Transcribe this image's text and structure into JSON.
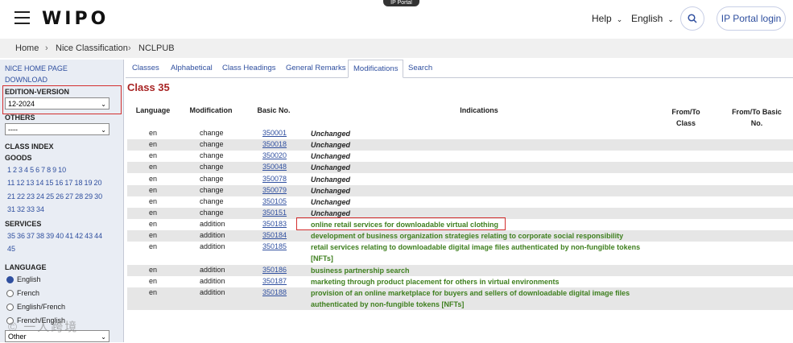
{
  "header": {
    "logo": "WIPO",
    "badge": "IP Portal",
    "help": "Help",
    "language": "English",
    "login": "IP Portal login"
  },
  "breadcrumb": [
    "Home",
    "Nice Classification",
    "NCLPUB"
  ],
  "sidebar": {
    "links": [
      "NICE HOME PAGE",
      "DOWNLOAD"
    ],
    "edition_label": "EDITION-VERSION",
    "edition_value": "12-2024",
    "others_label": "OTHERS",
    "others_value": "----",
    "class_index_label": "CLASS INDEX",
    "goods_label": "GOODS",
    "goods_rows": [
      [
        "1",
        "2",
        "3",
        "4",
        "5",
        "6",
        "7",
        "8",
        "9",
        "10"
      ],
      [
        "11",
        "12",
        "13",
        "14",
        "15",
        "16",
        "17",
        "18",
        "19",
        "20"
      ],
      [
        "21",
        "22",
        "23",
        "24",
        "25",
        "26",
        "27",
        "28",
        "29",
        "30"
      ],
      [
        "31",
        "32",
        "33",
        "34"
      ]
    ],
    "services_label": "SERVICES",
    "services_rows": [
      [
        "35",
        "36",
        "37",
        "38",
        "39",
        "40",
        "41",
        "42",
        "43",
        "44"
      ],
      [
        "45"
      ]
    ],
    "language_label": "LANGUAGE",
    "language_options": [
      "English",
      "French",
      "English/French",
      "French/English"
    ],
    "language_selected": "English",
    "other_select": "Other"
  },
  "tabs": [
    "Classes",
    "Alphabetical",
    "Class Headings",
    "General Remarks",
    "Modifications",
    "Search"
  ],
  "active_tab": "Modifications",
  "class_title": "Class 35",
  "table": {
    "headers": [
      "Language",
      "Modification",
      "Basic No.",
      "Indications",
      "From/To Class",
      "From/To Basic No."
    ],
    "rows": [
      {
        "lang": "en",
        "mod": "change",
        "basic": "350001",
        "ind": "Unchanged"
      },
      {
        "lang": "en",
        "mod": "change",
        "basic": "350018",
        "ind": "Unchanged"
      },
      {
        "lang": "en",
        "mod": "change",
        "basic": "350020",
        "ind": "Unchanged"
      },
      {
        "lang": "en",
        "mod": "change",
        "basic": "350048",
        "ind": "Unchanged"
      },
      {
        "lang": "en",
        "mod": "change",
        "basic": "350078",
        "ind": "Unchanged"
      },
      {
        "lang": "en",
        "mod": "change",
        "basic": "350079",
        "ind": "Unchanged"
      },
      {
        "lang": "en",
        "mod": "change",
        "basic": "350105",
        "ind": "Unchanged"
      },
      {
        "lang": "en",
        "mod": "change",
        "basic": "350151",
        "ind": "Unchanged"
      },
      {
        "lang": "en",
        "mod": "addition",
        "basic": "350183",
        "ind": "online retail services for downloadable virtual clothing"
      },
      {
        "lang": "en",
        "mod": "addition",
        "basic": "350184",
        "ind": "development of business organization strategies relating to corporate social responsibility"
      },
      {
        "lang": "en",
        "mod": "addition",
        "basic": "350185",
        "ind": "retail services relating to downloadable digital image files authenticated by non-fungible tokens [NFTs]"
      },
      {
        "lang": "en",
        "mod": "addition",
        "basic": "350186",
        "ind": "business partnership search"
      },
      {
        "lang": "en",
        "mod": "addition",
        "basic": "350187",
        "ind": "marketing through product placement for others in virtual environments"
      },
      {
        "lang": "en",
        "mod": "addition",
        "basic": "350188",
        "ind": "provision of an online marketplace for buyers and sellers of downloadable digital image files authenticated by non-fungible tokens [NFTs]"
      }
    ]
  },
  "watermark": "© 一人跨境"
}
